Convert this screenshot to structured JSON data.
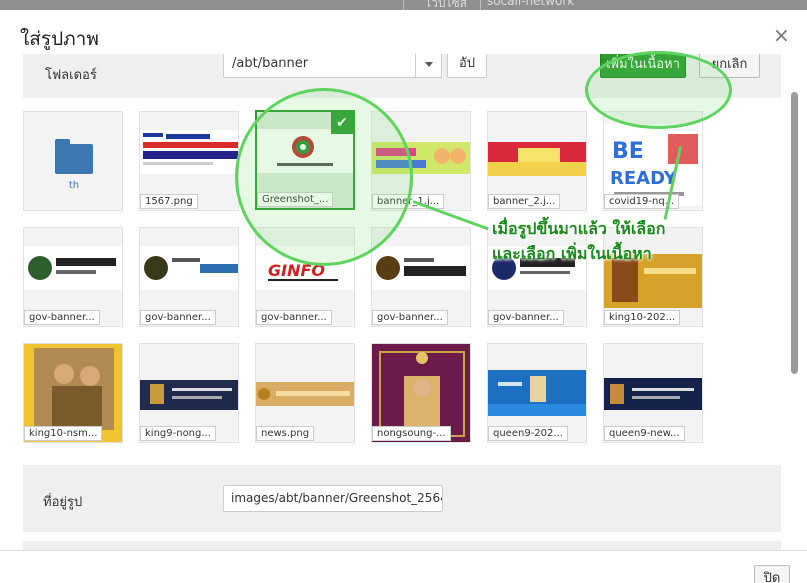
{
  "background": {
    "col1": "เว็ปไซส์",
    "col2": "socail-network"
  },
  "dialog": {
    "title": "ใส่รูปภาพ",
    "close_icon": "×",
    "folder_label": "โฟลเดอร์",
    "folder_value": "/abt/banner",
    "upload_label": "อัป",
    "insert_label": "เพิ่มในเนื้อหา",
    "cancel_label": "ยกเลิก",
    "address_label": "ที่อยู่รูป",
    "address_value": "images/abt/banner/Greenshot_2564",
    "close_label": "ปิด"
  },
  "folder": {
    "name": "th",
    "icon": "folder-icon"
  },
  "images": [
    {
      "name": "1567.png"
    },
    {
      "name": "Greenshot_...",
      "selected": true
    },
    {
      "name": "banner_1.j..."
    },
    {
      "name": "banner_2.j..."
    },
    {
      "name": "covid19-nq..."
    },
    {
      "name": "gov-banner..."
    },
    {
      "name": "gov-banner..."
    },
    {
      "name": "gov-banner..."
    },
    {
      "name": "gov-banner..."
    },
    {
      "name": "gov-banner..."
    },
    {
      "name": "king10-202..."
    },
    {
      "name": "king10-nsm..."
    },
    {
      "name": "king9-nong..."
    },
    {
      "name": "news.png"
    },
    {
      "name": "nongsoung-..."
    },
    {
      "name": "queen9-202..."
    },
    {
      "name": "queen9-new..."
    }
  ],
  "annotation": {
    "line1": "เมื่อรูปขึ้นมาแล้ว ให้เลือก",
    "line2": "และเลือก เพิ่มในเนื้อหา"
  },
  "colors": {
    "primary_green": "#2d9a2e",
    "annotation_green": "#5fd35f",
    "folder_blue": "#3d77b3"
  }
}
